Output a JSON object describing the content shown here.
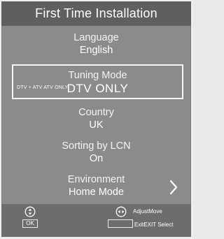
{
  "title": "First Time Installation",
  "menu": {
    "language": {
      "label": "Language",
      "value": "English"
    },
    "tuning_mode": {
      "label": "Tuning Mode",
      "value": "DTV ONLY",
      "options_line": "DTV + ATV ATV ONLY"
    },
    "country": {
      "label": "Country",
      "value": "UK"
    },
    "sorting_by_lcn": {
      "label": "Sorting by LCN",
      "value": "On"
    },
    "environment": {
      "label": "Environment",
      "value": "Home Mode"
    }
  },
  "footer": {
    "ok_key": "OK",
    "adjust_move": "AdjustMove",
    "exit_select": "ExitEXIT Select"
  },
  "icons": {
    "nav_updown": "updown-nav-icon",
    "nav_leftright": "leftright-nav-icon",
    "chevron_right": "chevron-right-icon"
  },
  "colors": {
    "panel_bg": "#8b8b8b",
    "title_bar_bg": "#5f5f5f",
    "footer_bg": "#6d6d6d",
    "text": "#ffffff",
    "highlight_border": "#f6f6f6"
  }
}
